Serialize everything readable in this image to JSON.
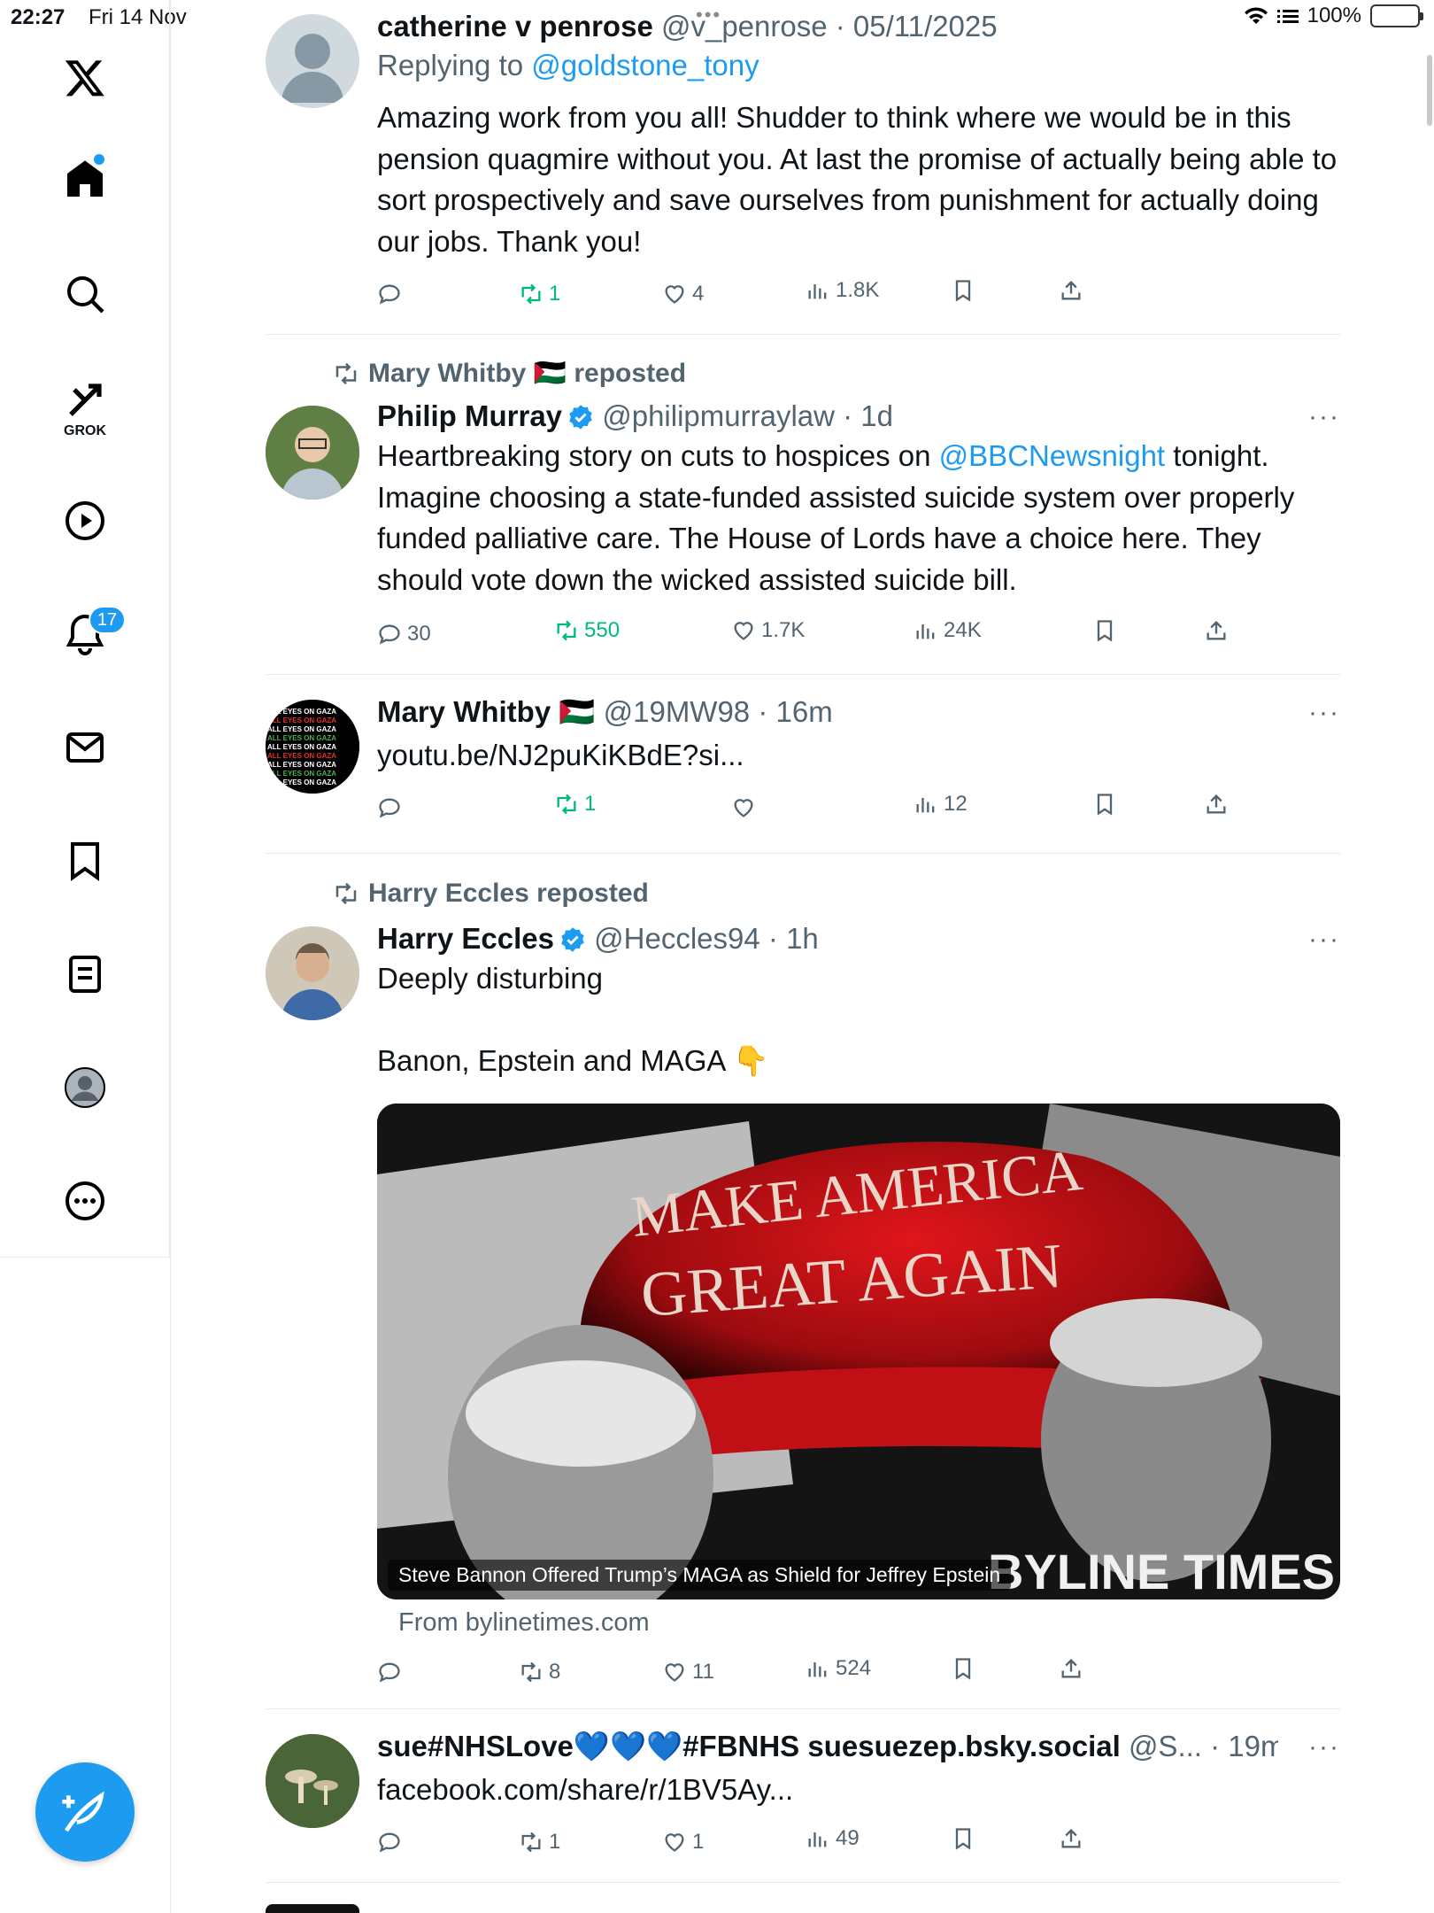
{
  "status_bar": {
    "time": "22:27",
    "date": "Fri 14 Nov",
    "battery": "100%",
    "dots": "•••"
  },
  "sidebar": {
    "grok_label": "GROK",
    "notifications_count": "17"
  },
  "tweets": [
    {
      "name": "catherine v penrose",
      "handle": "@v_penrose",
      "time": "· 05/11/2025",
      "reply_prefix": "Replying to ",
      "reply_to": "@goldstone_tony",
      "text": "Amazing work from you all! Shudder to think where we would be in this pension quagmire without you. At last the promise of actually being able to sort prospectively and save ourselves from punishment for actually doing our jobs. Thank you!",
      "replies": "",
      "reposts": "1",
      "likes": "4",
      "views": "1.8K"
    },
    {
      "repost_by": "Mary Whitby 🇵🇸 reposted",
      "name": "Philip Murray",
      "handle": "@philipmurraylaw",
      "time": "· 1d",
      "text_before": "Heartbreaking story on cuts to hospices on ",
      "mention": "@BBCNewsnight",
      "text_after": " tonight. Imagine choosing a state-funded assisted suicide system over properly funded palliative care. The House of Lords have a choice here. They should vote down the wicked assisted suicide bill.",
      "replies": "30",
      "reposts": "550",
      "likes": "1.7K",
      "views": "24K",
      "more": "···"
    },
    {
      "name": "Mary Whitby 🇵🇸",
      "handle": "@19MW98",
      "time": "· 16m",
      "link": "youtu.be/NJ2puKiKBdE?si...",
      "replies": "",
      "reposts": "1",
      "likes": "",
      "views": "12",
      "more": "···",
      "avatar_text": "ALL EYES ON GAZA CITY"
    },
    {
      "repost_by": "Harry Eccles reposted",
      "name": "Harry Eccles",
      "handle": "@Heccles94",
      "time": "· 1h",
      "text_line1": "Deeply disturbing",
      "text_line2": "Banon, Epstein and MAGA 👇",
      "card_caption": "Steve Bannon Offered Trump’s MAGA as Shield for Jeffrey Epstein",
      "card_hat_line1": "MAKE AMERICA",
      "card_hat_line2": "GREAT AGAIN",
      "card_brand": "BYLINE TIMES",
      "card_source": "From bylinetimes.com",
      "replies": "",
      "reposts": "8",
      "likes": "11",
      "views": "524",
      "more": "···"
    },
    {
      "name": "sue#NHSLove💙💙💙#FBNHS suesuezep.bsky.social",
      "handle": "@S...",
      "time": "· 19m",
      "link": "facebook.com/share/r/1BV5Ay...",
      "replies": "",
      "reposts": "1",
      "likes": "1",
      "views": "49",
      "more": "···"
    }
  ],
  "colors": {
    "accent": "#1d9bf0",
    "repost_green": "#00ba7c",
    "secondary_text": "#536471"
  }
}
